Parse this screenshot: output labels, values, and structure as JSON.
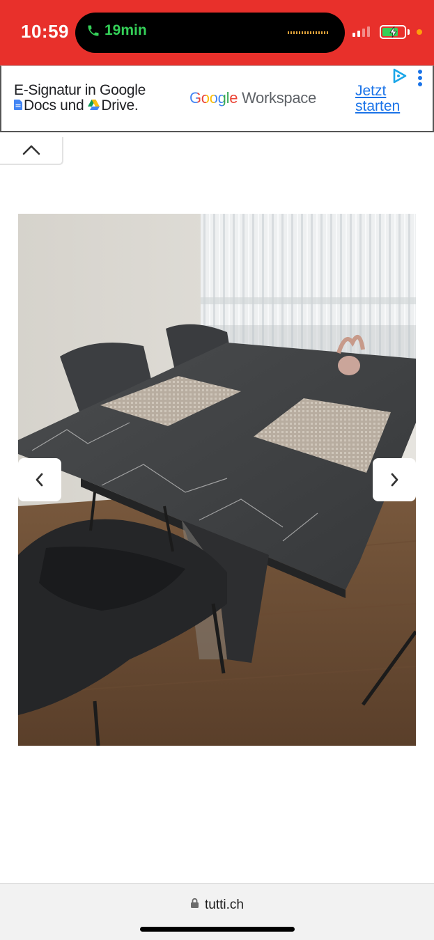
{
  "status_bar": {
    "time": "10:59",
    "call_duration": "19min"
  },
  "ad": {
    "headline_line1": "E-Signatur in Google",
    "headline_line2_a": "Docs und",
    "headline_line2_b": "Drive.",
    "logo_google": "Google",
    "logo_product": " Workspace",
    "cta_line1": "Jetzt",
    "cta_line2": "starten"
  },
  "browser": {
    "url": "tutti.ch"
  },
  "colors": {
    "status_bar_bg": "#e8302b",
    "call_green": "#34d058",
    "link_blue": "#1a73e8"
  },
  "icons": {
    "collapse": "chevron-up-icon",
    "prev": "chevron-left-icon",
    "next": "chevron-right-icon",
    "lock": "lock-icon",
    "phone": "phone-icon"
  }
}
